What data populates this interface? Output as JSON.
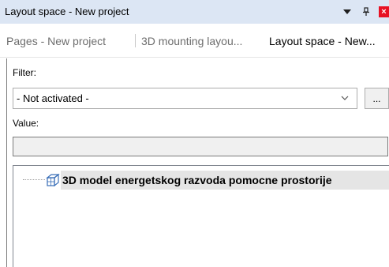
{
  "panel": {
    "title": "Layout space - New project",
    "dropdown_glyph": "▼",
    "pin_glyph": "ᵖ",
    "close_glyph": "×"
  },
  "tabs": [
    {
      "label": "Pages - New project",
      "active": false
    },
    {
      "label": "3D mounting layou...",
      "active": false
    },
    {
      "label": "Layout space - New...",
      "active": true
    }
  ],
  "filter": {
    "label": "Filter:",
    "selected": "- Not activated -",
    "more_label": "..."
  },
  "value": {
    "label": "Value:",
    "current": ""
  },
  "tree": {
    "items": [
      {
        "label": "3D model energetskog razvoda pomocne prostorije",
        "icon": "3d-layout-space-icon",
        "selected": true
      }
    ]
  },
  "colors": {
    "titlebar_bg": "#dce6f4",
    "close_red": "#e81123",
    "selection_bg": "#e5e5e5"
  }
}
